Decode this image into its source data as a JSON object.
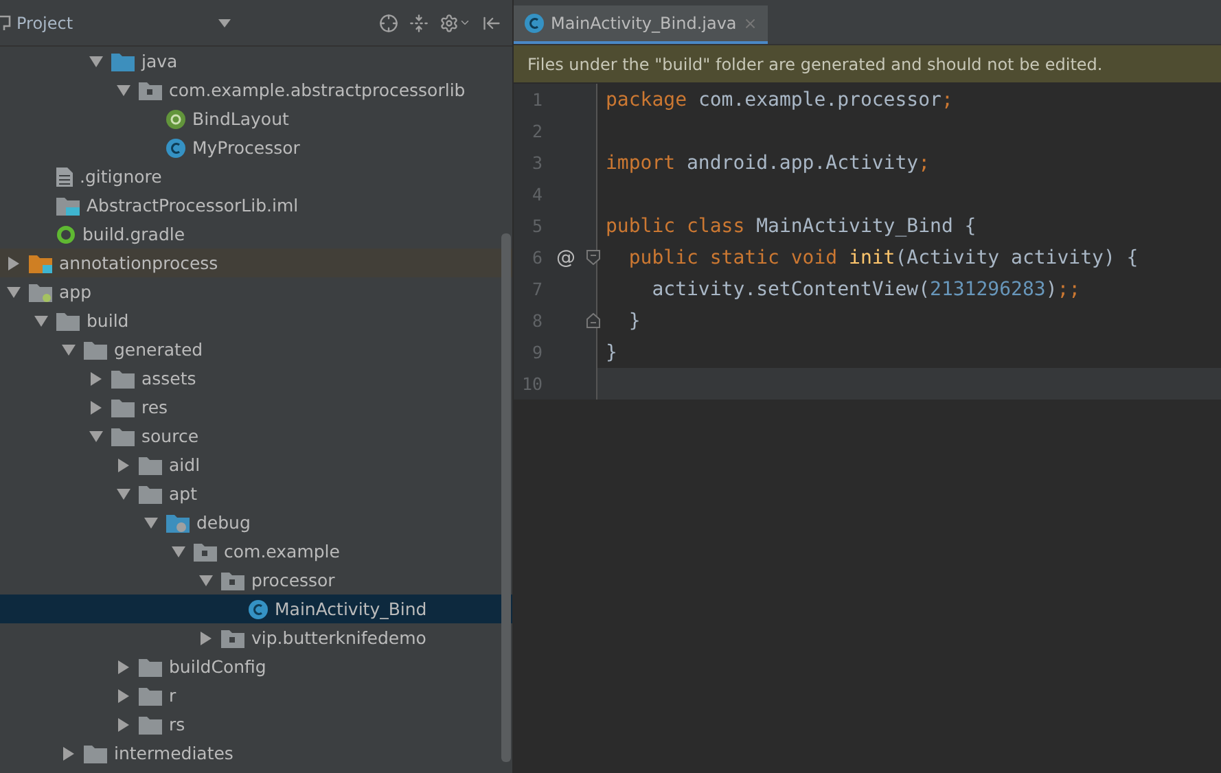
{
  "project_panel": {
    "title": "Project"
  },
  "tree": [
    {
      "children": [
        {
          "children": [
            {
              "children": [
                {
                  "label": "java",
                  "kind": "source-folder",
                  "expanded": true,
                  "selected": false,
                  "children": [
                    {
                      "label": "com.example.abstractprocessorlib",
                      "kind": "package",
                      "expanded": true,
                      "selected": false,
                      "children": [
                        {
                          "label": "BindLayout",
                          "kind": "annotation",
                          "selected": false
                        },
                        {
                          "label": "MyProcessor",
                          "kind": "class",
                          "selected": false
                        }
                      ]
                    }
                  ]
                }
              ]
            }
          ]
        },
        {
          "label": ".gitignore",
          "kind": "file",
          "selected": false
        },
        {
          "label": "AbstractProcessorLib.iml",
          "kind": "module-file",
          "selected": false
        },
        {
          "label": "build.gradle",
          "kind": "gradle",
          "selected": false
        }
      ]
    },
    {
      "label": "annotationprocess",
      "kind": "module",
      "expanded": false,
      "selected": false
    },
    {
      "label": "app",
      "kind": "app-module",
      "expanded": true,
      "selected": false,
      "children": [
        {
          "label": "build",
          "kind": "folder",
          "expanded": true,
          "selected": false,
          "children": [
            {
              "label": "generated",
              "kind": "folder",
              "expanded": true,
              "selected": false,
              "children": [
                {
                  "label": "assets",
                  "kind": "folder",
                  "expanded": false,
                  "selected": false
                },
                {
                  "label": "res",
                  "kind": "folder",
                  "expanded": false,
                  "selected": false
                },
                {
                  "label": "source",
                  "kind": "folder",
                  "expanded": true,
                  "selected": false,
                  "children": [
                    {
                      "label": "aidl",
                      "kind": "folder",
                      "expanded": false,
                      "selected": false
                    },
                    {
                      "label": "apt",
                      "kind": "folder",
                      "expanded": true,
                      "selected": false,
                      "children": [
                        {
                          "label": "debug",
                          "kind": "generated-folder",
                          "expanded": true,
                          "selected": false,
                          "children": [
                            {
                              "label": "com.example",
                              "kind": "package",
                              "expanded": true,
                              "selected": false,
                              "children": [
                                {
                                  "label": "processor",
                                  "kind": "package",
                                  "expanded": true,
                                  "selected": false,
                                  "children": [
                                    {
                                      "label": "MainActivity_Bind",
                                      "kind": "class",
                                      "selected": true
                                    }
                                  ]
                                },
                                {
                                  "label": "vip.butterknifedemo",
                                  "kind": "package",
                                  "expanded": false,
                                  "selected": false
                                }
                              ]
                            }
                          ]
                        }
                      ]
                    },
                    {
                      "label": "buildConfig",
                      "kind": "folder",
                      "expanded": false,
                      "selected": false
                    },
                    {
                      "label": "r",
                      "kind": "folder",
                      "expanded": false,
                      "selected": false
                    },
                    {
                      "label": "rs",
                      "kind": "folder",
                      "expanded": false,
                      "selected": false
                    }
                  ]
                }
              ]
            },
            {
              "label": "intermediates",
              "kind": "folder",
              "expanded": false,
              "selected": false
            }
          ]
        }
      ]
    }
  ],
  "editor_tabs": [
    {
      "label": "MainActivity_Bind.java",
      "close": "×",
      "selected": true
    }
  ],
  "banner": "Files under the \"build\" folder are generated and should not be edited.",
  "code_lines": [
    {
      "number": "1",
      "tokens": [
        {
          "kind": "keyword",
          "text": "package"
        },
        {
          "kind": "plain",
          "text": " com.example.processor"
        },
        {
          "kind": "punct",
          "text": ";"
        }
      ]
    },
    {
      "number": "2"
    },
    {
      "number": "3",
      "tokens": [
        {
          "kind": "keyword",
          "text": "import"
        },
        {
          "kind": "plain",
          "text": " android.app.Activity"
        },
        {
          "kind": "punct",
          "text": ";"
        }
      ]
    },
    {
      "number": "4"
    },
    {
      "number": "5",
      "tokens": [
        {
          "kind": "keyword",
          "text": "public class"
        },
        {
          "kind": "plain",
          "text": " MainActivity_Bind {"
        }
      ]
    },
    {
      "number": "6",
      "marker": "@",
      "fold_open": true,
      "tokens": [
        {
          "kind": "keyword",
          "text": "  public static void "
        },
        {
          "kind": "method",
          "text": "init"
        },
        {
          "kind": "plain",
          "text": "(Activity activity) {"
        }
      ]
    },
    {
      "number": "7",
      "tokens": [
        {
          "kind": "plain",
          "text": "    activity.setContentView("
        },
        {
          "kind": "number",
          "text": "2131296283"
        },
        {
          "kind": "plain",
          "text": ")"
        },
        {
          "kind": "punct",
          "text": ";;"
        }
      ]
    },
    {
      "number": "8",
      "fold_close": true,
      "tokens": [
        {
          "kind": "plain",
          "text": "  }"
        }
      ]
    },
    {
      "number": "9",
      "tokens": [
        {
          "kind": "plain",
          "text": "}"
        }
      ]
    },
    {
      "number": "10",
      "current": true
    }
  ]
}
